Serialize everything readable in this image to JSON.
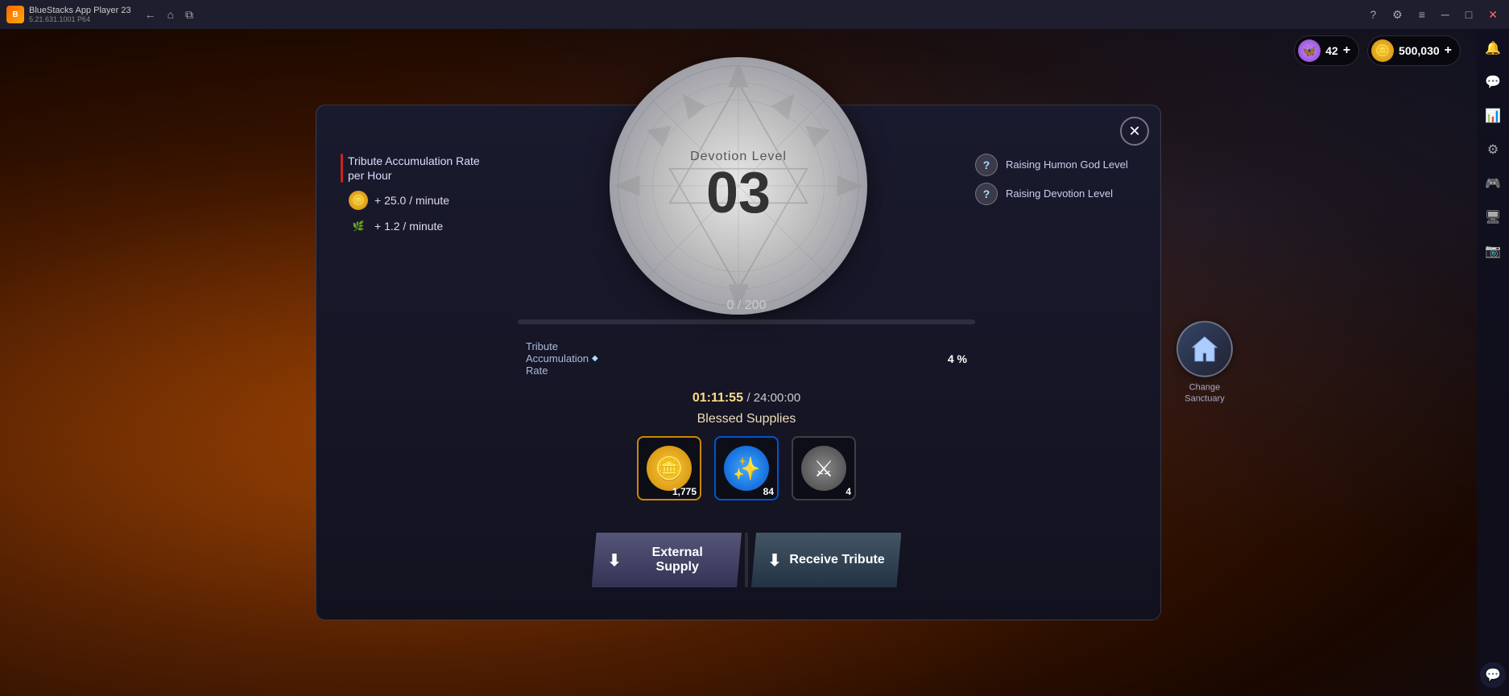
{
  "app": {
    "name": "BlueStacks App Player 23",
    "version": "5.21.631.1001 P64"
  },
  "topbar": {
    "back_label": "←",
    "home_label": "⌂",
    "copy_label": "⧉"
  },
  "topbar_right": {
    "minimize": "─",
    "maximize": "□",
    "close": "✕",
    "help": "?",
    "settings": "⚙",
    "menu": "≡"
  },
  "hud": {
    "butterfly_count": "42",
    "butterfly_plus": "+",
    "coin_count": "500,030",
    "coin_plus": "+"
  },
  "tribute_panel": {
    "title_line1": "Tribute Accumulation Rate",
    "title_line2": "per Hour",
    "rate1_value": "+ 25.0 / minute",
    "rate2_value": "+ 1.2 / minute"
  },
  "devotion": {
    "label": "Devotion Level",
    "level": "03",
    "progress_current": "0",
    "progress_max": "200",
    "progress_display": "0 / 200"
  },
  "accumulation": {
    "label": "Tribute\nAccumulation\nRate",
    "percent": "4 %",
    "timer": "01:11:55",
    "timer_separator": "/",
    "timer_max": "24:00:00"
  },
  "blessed_supplies": {
    "label": "Blessed Supplies",
    "items": [
      {
        "type": "gold",
        "count": "1,775",
        "display_count": "1,775"
      },
      {
        "type": "exp",
        "count": "84",
        "display_count": "84"
      },
      {
        "type": "item3",
        "count": "4",
        "display_count": "4"
      }
    ]
  },
  "buttons": {
    "external_supply": "External Supply",
    "receive_tribute": "Receive Tribute"
  },
  "help_items": [
    {
      "label": "Raising Humon God Level"
    },
    {
      "label": "Raising Devotion Level"
    }
  ],
  "change_sanctuary": {
    "label": "Change\nSanctuary"
  },
  "sidebar_icons": [
    "🔔",
    "💬",
    "📊",
    "⚙",
    "🎮",
    "🖥",
    "📷"
  ]
}
